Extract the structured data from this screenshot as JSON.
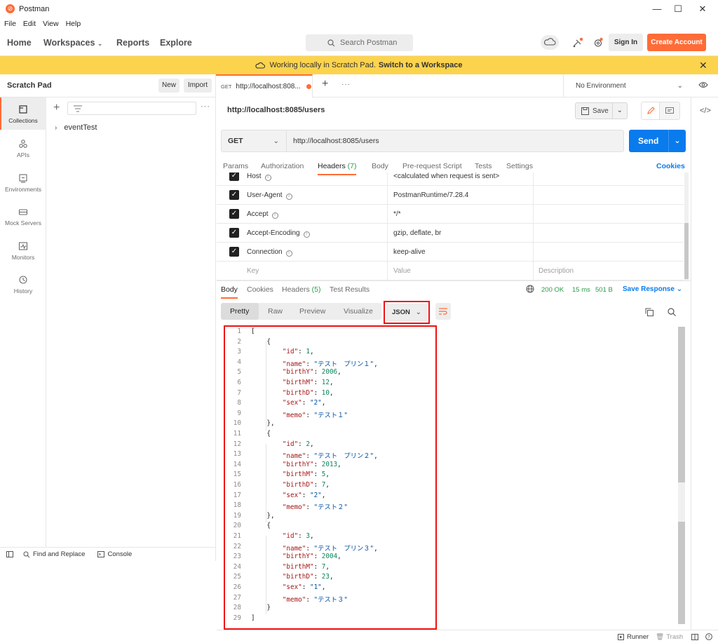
{
  "window": {
    "title": "Postman",
    "controls": [
      "—",
      "☐",
      "✕"
    ]
  },
  "menu": [
    "File",
    "Edit",
    "View",
    "Help"
  ],
  "header": {
    "nav": [
      "Home",
      "Workspaces",
      "Reports",
      "Explore"
    ],
    "search_placeholder": "Search Postman",
    "sign_in": "Sign In",
    "create_account": "Create Account"
  },
  "banner": {
    "text": "Working locally in Scratch Pad.",
    "link": "Switch to a Workspace"
  },
  "sidebar": {
    "title": "Scratch Pad",
    "new": "New",
    "import": "Import",
    "rail": [
      "Collections",
      "APIs",
      "Environments",
      "Mock Servers",
      "Monitors",
      "History"
    ],
    "collection": "eventTest",
    "footer": {
      "find_replace": "Find and Replace",
      "console": "Console"
    }
  },
  "tab": {
    "method": "GET",
    "label": "http://localhost:808...",
    "environment": "No Environment"
  },
  "request": {
    "title": "http://localhost:8085/users",
    "save": "Save",
    "method": "GET",
    "url": "http://localhost:8085/users",
    "send": "Send",
    "tabs": [
      "Params",
      "Authorization",
      "Headers",
      "Body",
      "Pre-request Script",
      "Tests",
      "Settings"
    ],
    "headers_count": "(7)",
    "cookies": "Cookies"
  },
  "headers_table": {
    "rows": [
      {
        "key": "Host",
        "value": "<calculated when request is sent>"
      },
      {
        "key": "User-Agent",
        "value": "PostmanRuntime/7.28.4"
      },
      {
        "key": "Accept",
        "value": "*/*"
      },
      {
        "key": "Accept-Encoding",
        "value": "gzip, deflate, br"
      },
      {
        "key": "Connection",
        "value": "keep-alive"
      }
    ],
    "placeholder": {
      "key": "Key",
      "value": "Value",
      "description": "Description"
    }
  },
  "response": {
    "tabs": [
      "Body",
      "Cookies",
      "Headers",
      "Test Results"
    ],
    "headers_count": "(5)",
    "status": "200 OK",
    "time": "15 ms",
    "size": "501 B",
    "save_response": "Save Response",
    "views": [
      "Pretty",
      "Raw",
      "Preview",
      "Visualize"
    ],
    "format": "JSON"
  },
  "json_lines": [
    "[",
    "    {",
    "        \"id\": 1,",
    "        \"name\": \"テスト　プリン１\",",
    "        \"birthY\": 2006,",
    "        \"birthM\": 12,",
    "        \"birthD\": 10,",
    "        \"sex\": \"2\",",
    "        \"memo\": \"テスト１\"",
    "    },",
    "    {",
    "        \"id\": 2,",
    "        \"name\": \"テスト　プリン２\",",
    "        \"birthY\": 2013,",
    "        \"birthM\": 5,",
    "        \"birthD\": 7,",
    "        \"sex\": \"2\",",
    "        \"memo\": \"テスト２\"",
    "    },",
    "    {",
    "        \"id\": 3,",
    "        \"name\": \"テスト　プリン３\",",
    "        \"birthY\": 2004,",
    "        \"birthM\": 7,",
    "        \"birthD\": 23,",
    "        \"sex\": \"1\",",
    "        \"memo\": \"テスト３\"",
    "    }",
    "]"
  ],
  "bottom_bar": {
    "runner": "Runner",
    "trash": "Trash"
  },
  "colors": {
    "accent": "#ff6c37",
    "send": "#097bed",
    "banner": "#fcd34d",
    "highlight": "#e11111"
  }
}
